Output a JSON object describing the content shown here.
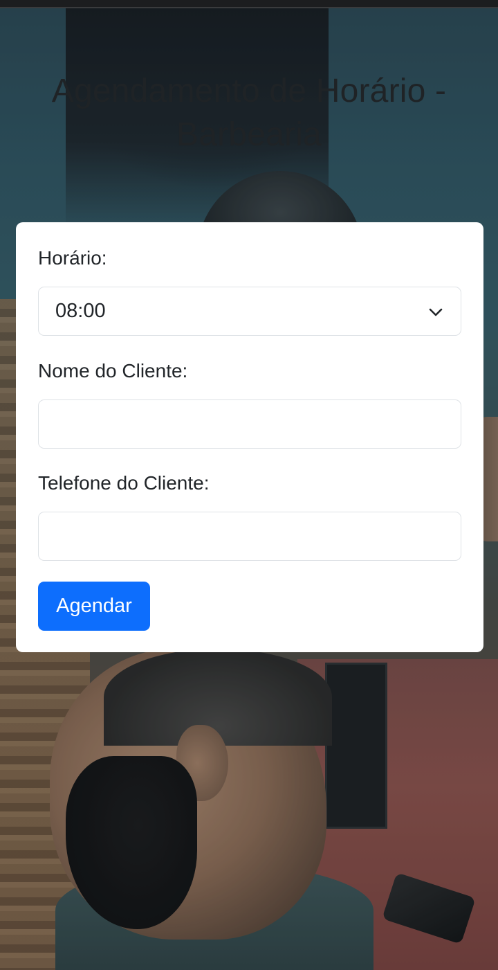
{
  "page": {
    "title": "Agendamento de Horário - Barbearia"
  },
  "form": {
    "time_label": "Horário:",
    "time_selected": "08:00",
    "name_label": "Nome do Cliente:",
    "name_value": "",
    "phone_label": "Telefone do Cliente:",
    "phone_value": "",
    "submit_label": "Agendar"
  },
  "colors": {
    "primary": "#0d6efd",
    "card_background": "#ffffff",
    "text": "#212529"
  },
  "icons": {
    "select_chevron": "chevron-down-icon"
  }
}
